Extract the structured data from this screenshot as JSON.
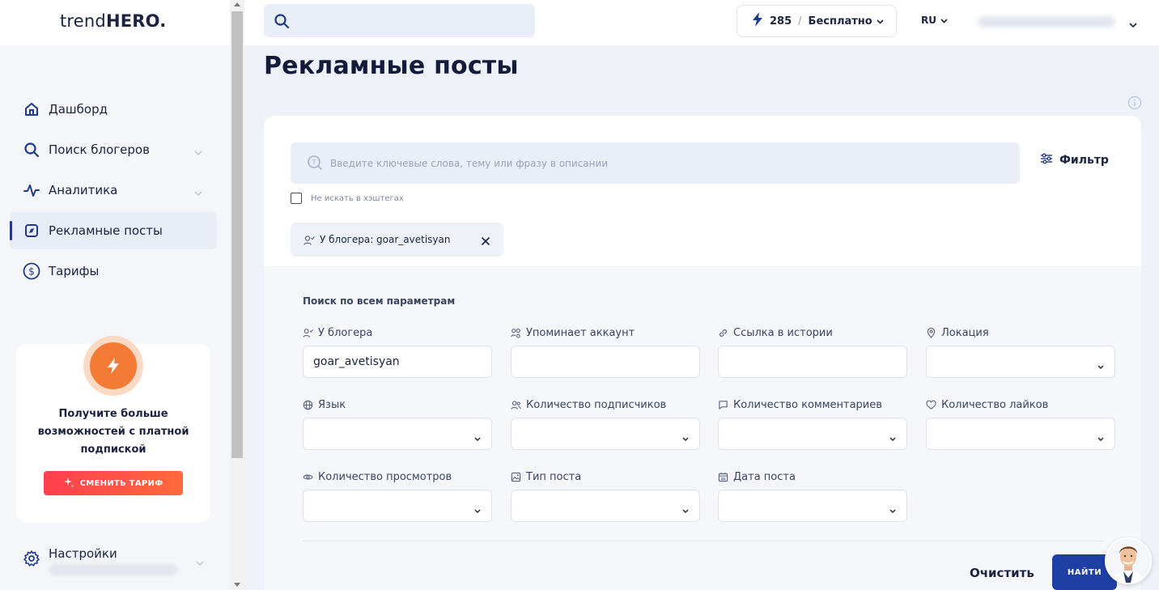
{
  "logo": {
    "light": "trend",
    "bold": "HERO."
  },
  "sidebar": {
    "items": [
      {
        "label": "Дашборд",
        "icon": "home-icon"
      },
      {
        "label": "Поиск блогеров",
        "icon": "search-icon",
        "has_submenu": true
      },
      {
        "label": "Аналитика",
        "icon": "analytics-icon",
        "has_submenu": true
      },
      {
        "label": "Рекламные посты",
        "icon": "ad-post-icon",
        "active": true
      },
      {
        "label": "Тарифы",
        "icon": "dollar-icon"
      }
    ],
    "promo": {
      "text": "Получите больше возможностей с платной подпиской",
      "button": "СМЕНИТЬ ТАРИФ"
    },
    "settings": {
      "label": "Настройки"
    }
  },
  "topbar": {
    "credits": "285",
    "separator": "/",
    "plan": "Бесплатно",
    "lang": "RU"
  },
  "page": {
    "title": "Рекламные посты",
    "keyword_placeholder": "Введите ключевые слова, тему или фразу в описании",
    "filter_label": "Фильтр",
    "no_hashtags_label": "Не искать в хэштегах",
    "chip_label": "У блогера: goar_avetisyan"
  },
  "advanced": {
    "title": "Поиск по всем параметрам",
    "fields": [
      {
        "label": "У блогера",
        "value": "goar_avetisyan",
        "icon": "user-check-icon",
        "type": "input"
      },
      {
        "label": "Упоминает аккаунт",
        "value": "",
        "icon": "users-mention-icon",
        "type": "input"
      },
      {
        "label": "Ссылка в истории",
        "value": "",
        "icon": "link-icon",
        "type": "input"
      },
      {
        "label": "Локация",
        "value": "",
        "icon": "location-pin-icon",
        "type": "select"
      },
      {
        "label": "Язык",
        "value": "",
        "icon": "globe-icon",
        "type": "select"
      },
      {
        "label": "Количество подписчиков",
        "value": "",
        "icon": "followers-icon",
        "type": "select"
      },
      {
        "label": "Количество комментариев",
        "value": "",
        "icon": "comment-icon",
        "type": "select"
      },
      {
        "label": "Количество лайков",
        "value": "",
        "icon": "heart-icon",
        "type": "select"
      },
      {
        "label": "Количество просмотров",
        "value": "",
        "icon": "eye-icon",
        "type": "select"
      },
      {
        "label": "Тип поста",
        "value": "",
        "icon": "image-icon",
        "type": "select"
      },
      {
        "label": "Дата поста",
        "value": "",
        "icon": "calendar-icon",
        "type": "select"
      }
    ],
    "clear_label": "Очистить",
    "find_label": "НАЙТИ"
  },
  "colors": {
    "accent": "#1e3fa5",
    "promo_orange": "#f47b36",
    "promo_button": "#ff4a45"
  }
}
